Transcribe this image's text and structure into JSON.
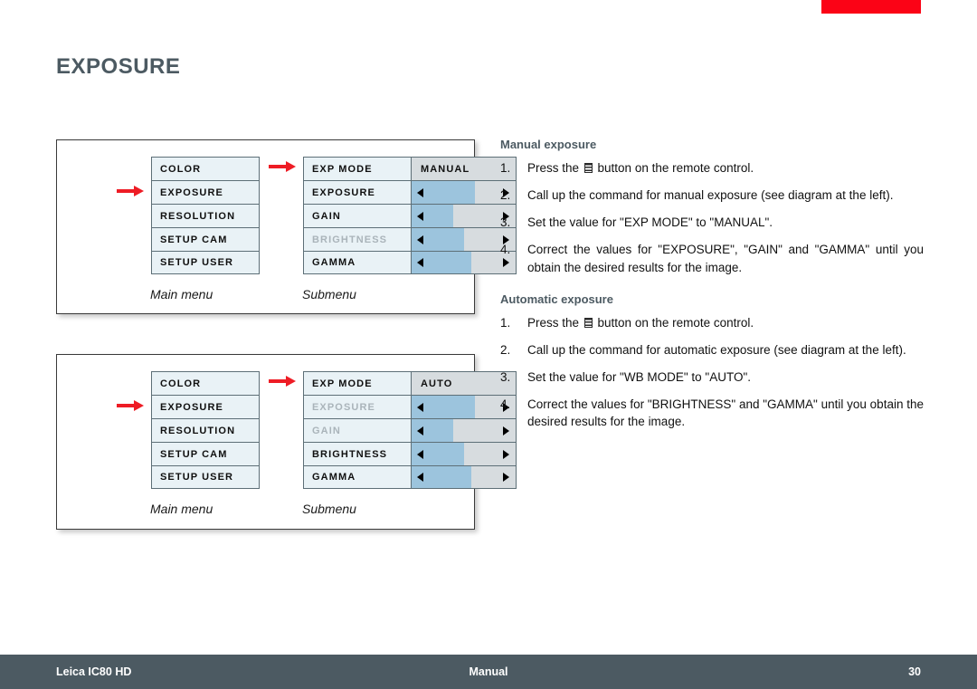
{
  "page": {
    "title": "EXPOSURE",
    "accent_color": "#fb0316",
    "heading_color": "#4c5a62",
    "footer_color": "#4c5a62"
  },
  "diagrams": [
    {
      "id": "manual",
      "main_menu": {
        "caption": "Main menu",
        "items": [
          {
            "label": "COLOR",
            "dim": false,
            "selected": false
          },
          {
            "label": "EXPOSURE",
            "dim": false,
            "selected": true
          },
          {
            "label": "RESOLUTION",
            "dim": false,
            "selected": false
          },
          {
            "label": "SETUP CAM",
            "dim": false,
            "selected": false
          },
          {
            "label": "SETUP USER",
            "dim": false,
            "selected": false
          }
        ]
      },
      "submenu": {
        "caption": "Submenu",
        "items": [
          {
            "label": "EXP MODE",
            "dim": false,
            "type": "value",
            "value": "MANUAL"
          },
          {
            "label": "EXPOSURE",
            "dim": false,
            "type": "slider",
            "fill_percent": 61
          },
          {
            "label": "GAIN",
            "dim": false,
            "type": "slider",
            "fill_percent": 40
          },
          {
            "label": "BRIGHTNESS",
            "dim": true,
            "type": "slider",
            "fill_percent": 50
          },
          {
            "label": "GAMMA",
            "dim": false,
            "type": "slider",
            "fill_percent": 57
          }
        ]
      }
    },
    {
      "id": "auto",
      "main_menu": {
        "caption": "Main menu",
        "items": [
          {
            "label": "COLOR",
            "dim": false,
            "selected": false
          },
          {
            "label": "EXPOSURE",
            "dim": false,
            "selected": true
          },
          {
            "label": "RESOLUTION",
            "dim": false,
            "selected": false
          },
          {
            "label": "SETUP CAM",
            "dim": false,
            "selected": false
          },
          {
            "label": "SETUP USER",
            "dim": false,
            "selected": false
          }
        ]
      },
      "submenu": {
        "caption": "Submenu",
        "items": [
          {
            "label": "EXP MODE",
            "dim": false,
            "type": "value",
            "value": "AUTO"
          },
          {
            "label": "EXPOSURE",
            "dim": true,
            "type": "slider",
            "fill_percent": 61
          },
          {
            "label": "GAIN",
            "dim": true,
            "type": "slider",
            "fill_percent": 40
          },
          {
            "label": "BRIGHTNESS",
            "dim": false,
            "type": "slider",
            "fill_percent": 50
          },
          {
            "label": "GAMMA",
            "dim": false,
            "type": "slider",
            "fill_percent": 57
          }
        ]
      }
    }
  ],
  "sections": [
    {
      "title": "Manual exposure",
      "steps": [
        {
          "num": "1.",
          "pre": "Press the ",
          "icon": "menu-button-icon",
          "post": " button on the remote control.",
          "justify": false
        },
        {
          "num": "2.",
          "pre": "Call up the command for manual exposure (see diagram at the left).",
          "icon": null,
          "post": "",
          "justify": false
        },
        {
          "num": "3.",
          "pre": "Set the value for \"EXP MODE\" to \"MANUAL\".",
          "icon": null,
          "post": "",
          "justify": false
        },
        {
          "num": "4.",
          "pre": "Correct the values for \"EXPOSURE\", \"GAIN\" and \"GAMMA\" until you obtain the desired results for the image.",
          "icon": null,
          "post": "",
          "justify": true
        }
      ]
    },
    {
      "title": "Automatic exposure",
      "steps": [
        {
          "num": "1.",
          "pre": "Press the ",
          "icon": "menu-button-icon",
          "post": " button on the remote control.",
          "justify": false
        },
        {
          "num": "2.",
          "pre": "Call up the command for automatic exposure (see diagram at the left).",
          "icon": null,
          "post": "",
          "justify": true
        },
        {
          "num": "3.",
          "pre": "Set the value for \"WB MODE\" to \"AUTO\".",
          "icon": null,
          "post": "",
          "justify": false
        },
        {
          "num": "4.",
          "pre": "Correct the values for \"BRIGHTNESS\" and \"GAMMA\" until you obtain the desired results for the image.",
          "icon": null,
          "post": "",
          "justify": true
        }
      ]
    }
  ],
  "footer": {
    "left": "Leica IC80 HD",
    "center": "Manual",
    "right": "30"
  }
}
